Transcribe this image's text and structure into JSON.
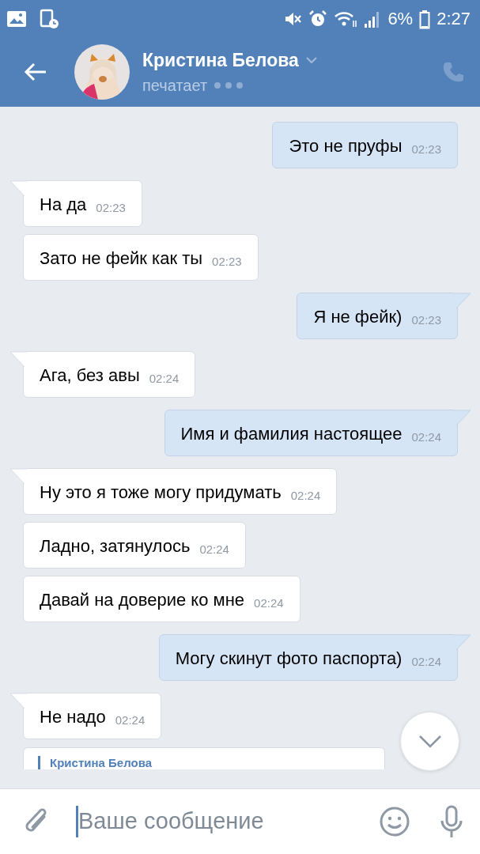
{
  "status_bar": {
    "battery": "6%",
    "time": "2:27"
  },
  "header": {
    "name": "Кристина Белова",
    "status": "печатает"
  },
  "messages": [
    {
      "kind": "outgoing",
      "tail": false,
      "text": "Это не пруфы",
      "time": "02:23"
    },
    {
      "kind": "incoming",
      "tail": true,
      "text": "На да",
      "time": "02:23"
    },
    {
      "kind": "incoming",
      "tail": false,
      "text": "Зато не фейк как ты",
      "time": "02:23"
    },
    {
      "kind": "outgoing",
      "tail": true,
      "text": "Я не фейк)",
      "time": "02:23"
    },
    {
      "kind": "incoming",
      "tail": true,
      "text": "Ага, без авы",
      "time": "02:24"
    },
    {
      "kind": "outgoing",
      "tail": true,
      "text": "Имя и фамилия настоящее",
      "time": "02:24"
    },
    {
      "kind": "incoming",
      "tail": true,
      "text": "Ну это я тоже могу придумать",
      "time": "02:24"
    },
    {
      "kind": "incoming",
      "tail": false,
      "text": "Ладно, затянулось",
      "time": "02:24"
    },
    {
      "kind": "incoming",
      "tail": false,
      "text": "Давай на доверие ко мне",
      "time": "02:24"
    },
    {
      "kind": "outgoing",
      "tail": true,
      "text": "Могу скинут фото паспорта)",
      "time": "02:24"
    },
    {
      "kind": "incoming",
      "tail": true,
      "text": "Не надо",
      "time": "02:24"
    }
  ],
  "partial_message": {
    "forwarded_from": "Кристина Белова"
  },
  "composer": {
    "placeholder": "Ваше сообщение"
  }
}
